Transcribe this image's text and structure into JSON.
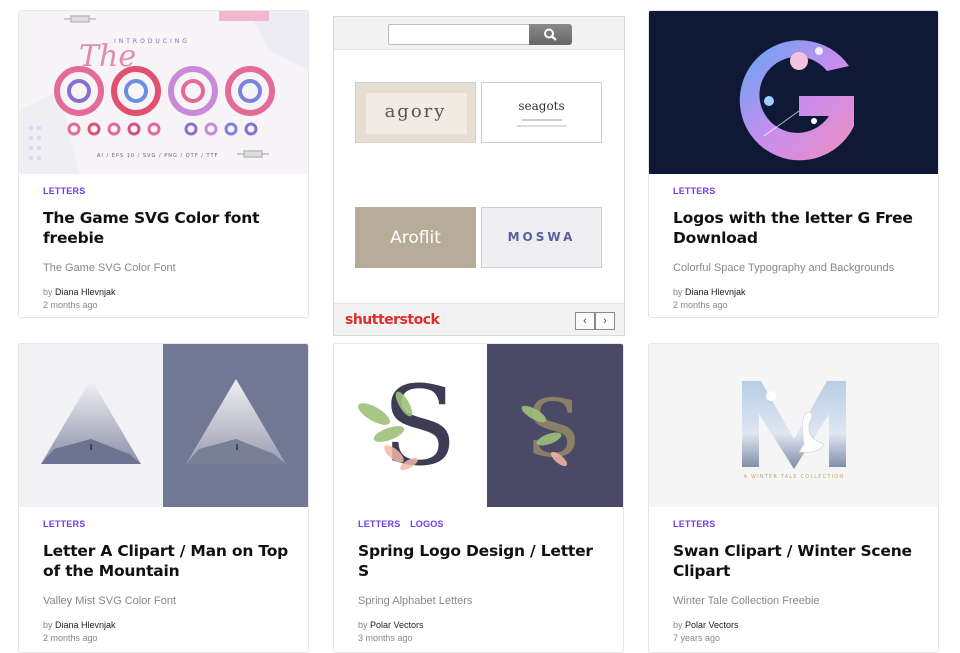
{
  "cards": [
    {
      "categories": [
        "LETTERS"
      ],
      "title": "The Game SVG Color font freebie",
      "excerpt": "The Game SVG Color Font",
      "by": "by",
      "author": "Diana Hlevnjak",
      "time": "2 months ago",
      "thumb_text": {
        "intro": "INTRODUCING",
        "the": "The",
        "formats": "AI / EPS 10 / SVG / PNG / OTF / TTF"
      }
    },
    {
      "categories": [
        "LETTERS"
      ],
      "title": "Logos with the letter G Free Download",
      "excerpt": "Colorful Space Typography and Backgrounds",
      "by": "by",
      "author": "Diana Hlevnjak",
      "time": "2 months ago"
    },
    {
      "categories": [
        "LETTERS"
      ],
      "title": "Letter A Clipart / Man on Top of the Mountain",
      "excerpt": "Valley Mist SVG Color Font",
      "by": "by",
      "author": "Diana Hlevnjak",
      "time": "2 months ago"
    },
    {
      "categories": [
        "LETTERS",
        "LOGOS"
      ],
      "title": "Spring Logo Design / Letter S",
      "excerpt": "Spring Alphabet Letters",
      "by": "by",
      "author": "Polar Vectors",
      "time": "3 months ago"
    },
    {
      "categories": [
        "LETTERS"
      ],
      "title": "Swan Clipart / Winter Scene Clipart",
      "excerpt": "Winter Tale Collection Freebie",
      "by": "by",
      "author": "Polar Vectors",
      "time": "7 years ago",
      "thumb_text": {
        "caption": "A WINTER TALE COLLECTION"
      }
    }
  ],
  "ad": {
    "search_placeholder": "",
    "tiles": [
      "agory",
      "seagots",
      "Aroflit",
      "MOSWA"
    ],
    "logo": "shutterstock",
    "prev": "‹",
    "next": "›"
  },
  "colors": {
    "category": "#6e3ee6",
    "title": "#111111",
    "meta": "#888888",
    "brand_red": "#e02c2c"
  },
  "icons": [
    "search-icon",
    "chevron-left-icon",
    "chevron-right-icon"
  ]
}
